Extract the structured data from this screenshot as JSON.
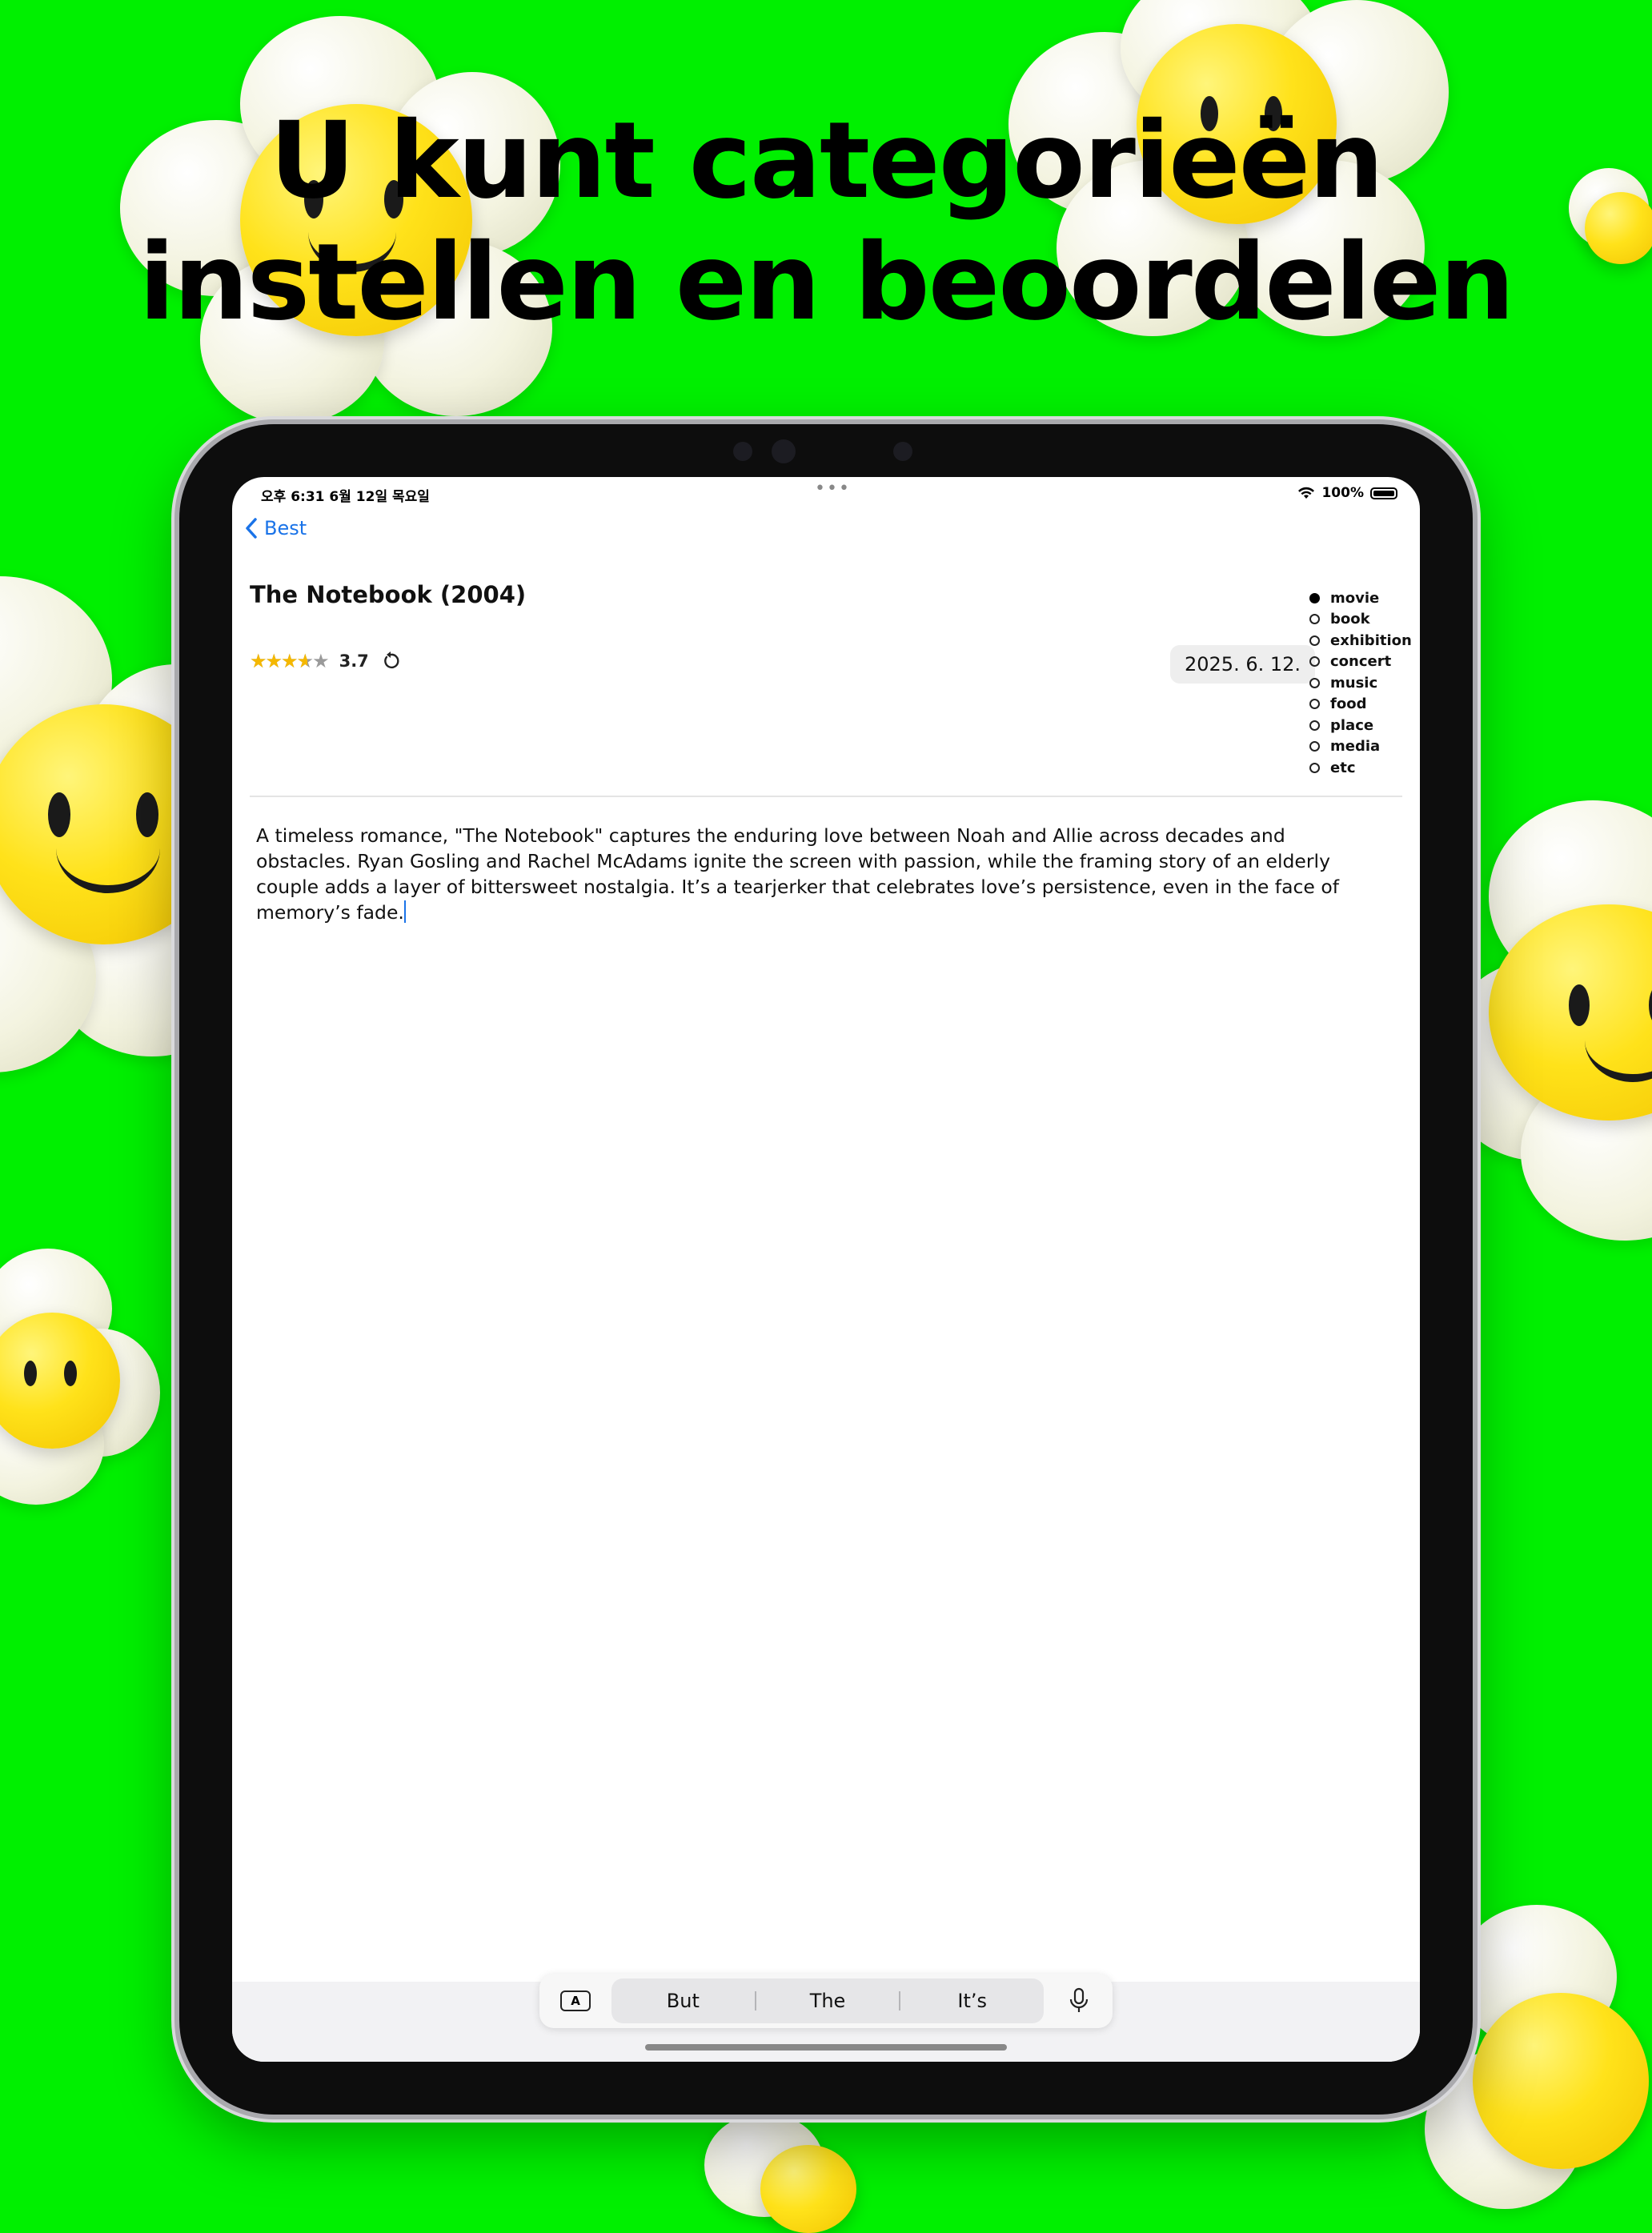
{
  "headline": {
    "line1": "U kunt categorieën",
    "line2": "instellen en beoordelen"
  },
  "status_bar": {
    "time": "오후 6:31   6월 12일 목요일",
    "battery": "100%"
  },
  "nav": {
    "back_label": "Best"
  },
  "item": {
    "title": "The Notebook (2004)",
    "rating": 3.7,
    "rating_label": "3.7",
    "stars_glyphs": "★★★★★",
    "date": "2025. 6. 12."
  },
  "categories": [
    {
      "label": "movie",
      "selected": true
    },
    {
      "label": "book",
      "selected": false
    },
    {
      "label": "exhibition",
      "selected": false
    },
    {
      "label": "concert",
      "selected": false
    },
    {
      "label": "music",
      "selected": false
    },
    {
      "label": "food",
      "selected": false
    },
    {
      "label": "place",
      "selected": false
    },
    {
      "label": "media",
      "selected": false
    },
    {
      "label": "etc",
      "selected": false
    }
  ],
  "review": {
    "text": "A timeless romance, \"The Notebook\" captures the enduring love between Noah and Allie across decades and obstacles. Ryan Gosling and Rachel McAdams ignite the screen with passion, while the framing story of an elderly couple adds a layer of bittersweet nostalgia. It’s a tearjerker that celebrates love’s persistence, even in the face of memory’s fade."
  },
  "keyboard": {
    "toggle_label": "A",
    "suggestions": [
      "But",
      "The",
      "It’s"
    ]
  },
  "colors": {
    "background": "#00f000",
    "accent": "#1a73e8",
    "star": "#f5b800"
  },
  "icons": [
    "chevron-left-icon",
    "star-icon",
    "reset-icon",
    "wifi-icon",
    "battery-icon",
    "microphone-icon",
    "keyboard-toggle-icon"
  ]
}
